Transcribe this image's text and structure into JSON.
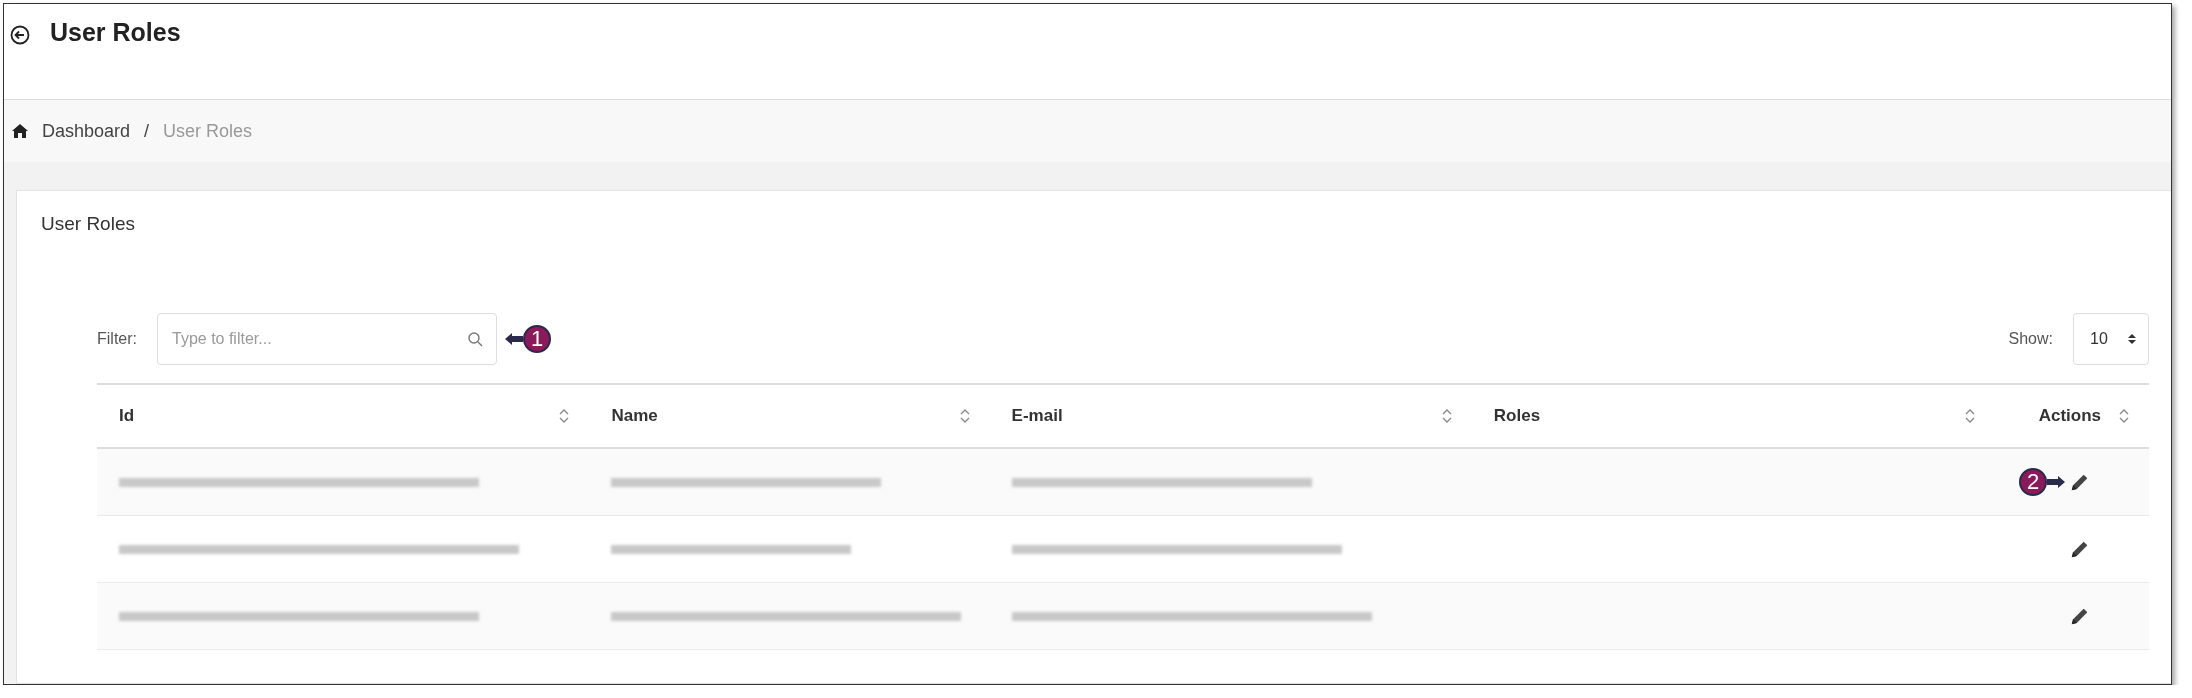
{
  "header": {
    "title": "User Roles"
  },
  "breadcrumb": [
    {
      "label": "Dashboard",
      "current": false
    },
    {
      "label": "/",
      "current": false
    },
    {
      "label": "User Roles",
      "current": true
    }
  ],
  "card": {
    "title": "User Roles"
  },
  "filter": {
    "label": "Filter:",
    "placeholder": "Type to filter...",
    "callout": "1"
  },
  "show": {
    "label": "Show:",
    "value": "10"
  },
  "table": {
    "columns": [
      {
        "label": "Id"
      },
      {
        "label": "Name"
      },
      {
        "label": "E-mail"
      },
      {
        "label": "Roles"
      },
      {
        "label": "Actions"
      }
    ],
    "rows": [
      {
        "kind": "redacted",
        "callout": "2"
      },
      {
        "kind": "redacted"
      },
      {
        "kind": "redacted"
      }
    ]
  }
}
